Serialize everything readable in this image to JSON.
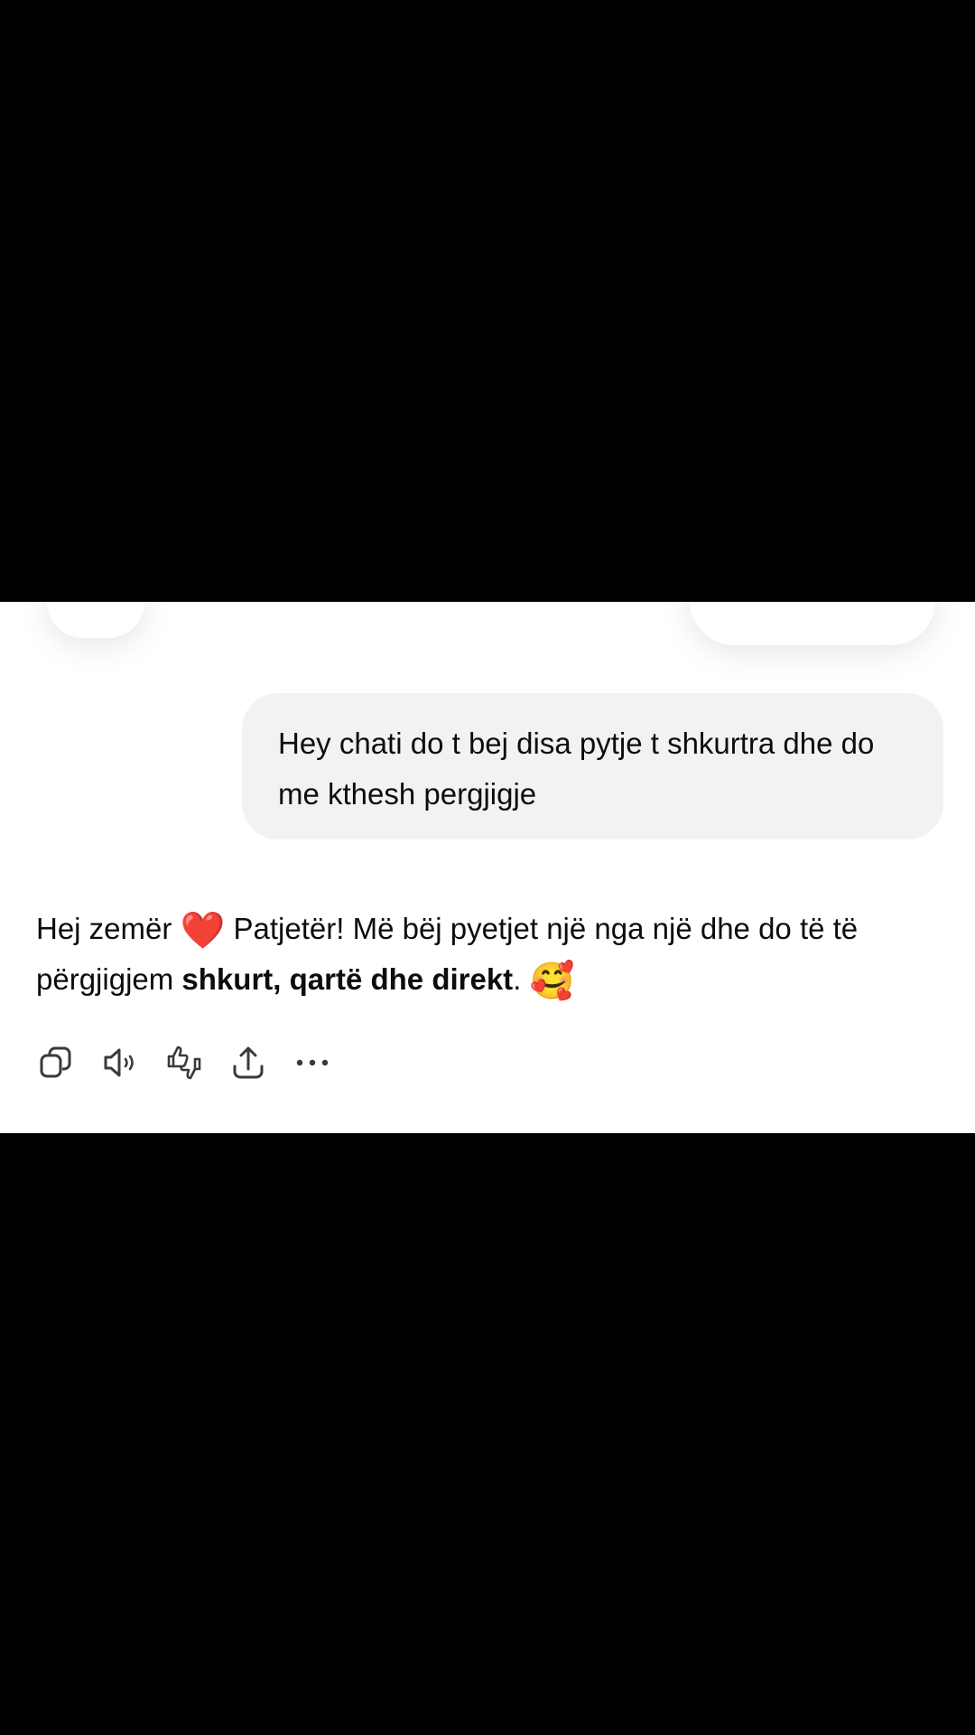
{
  "header": {
    "menu_icon": "menu-icon",
    "new_chat_icon": "new-chat-icon"
  },
  "conversation": {
    "user_message": "Hey chati do t bej disa pytje t shkurtra dhe do me kthesh pergjigje",
    "assistant_message": {
      "part1": "Hej zemër ",
      "heart_emoji": "❤️",
      "part2": " Patjetër! Më bëj pyetjet një nga një dhe do të të përgjigjem ",
      "bold": "shkurt, qartë dhe direkt",
      "part3": ". ",
      "end_emoji": "🥰"
    }
  },
  "actions": [
    {
      "name": "copy",
      "icon": "copy-icon"
    },
    {
      "name": "read-aloud",
      "icon": "speaker-icon"
    },
    {
      "name": "feedback",
      "icon": "thumbs-up-down-icon"
    },
    {
      "name": "share",
      "icon": "share-icon"
    },
    {
      "name": "more",
      "icon": "more-icon"
    }
  ],
  "colors": {
    "bubble_bg": "#f2f2f2",
    "text": "#0d0d0d",
    "icon": "#3a3a3a",
    "frame": "#000000"
  }
}
